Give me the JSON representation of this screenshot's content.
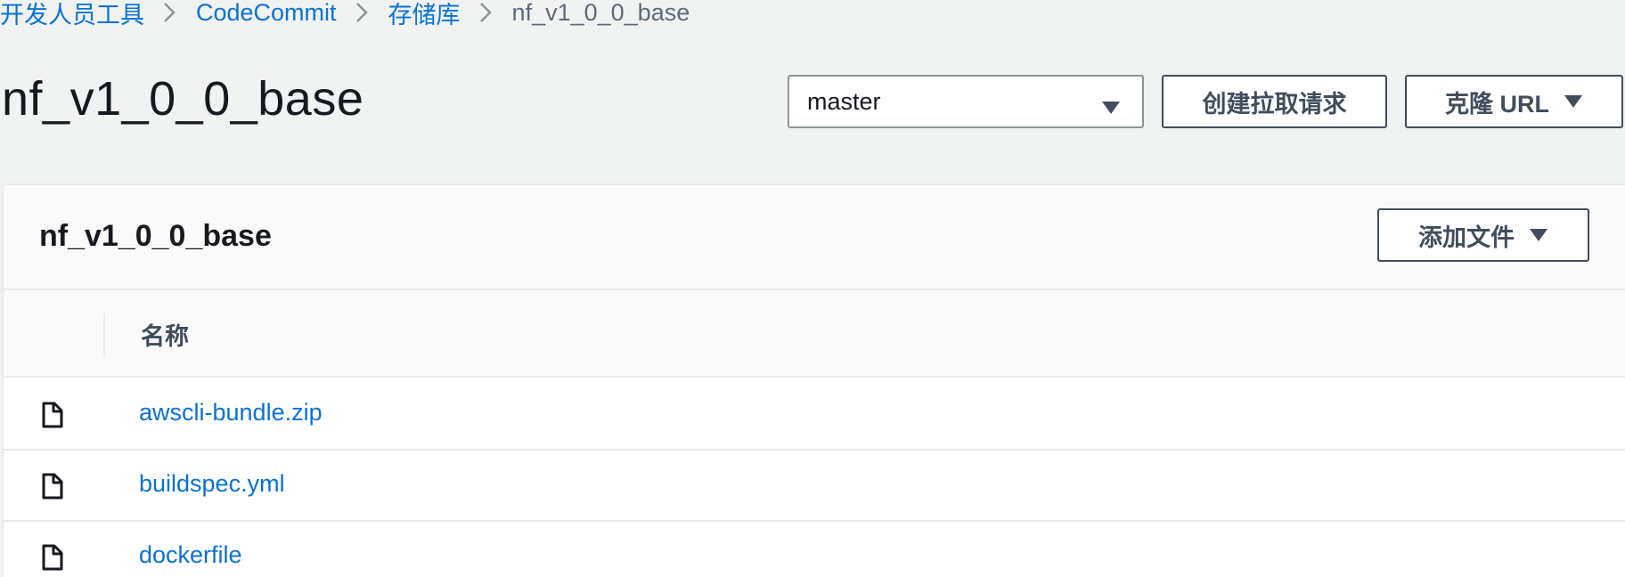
{
  "breadcrumb": {
    "items": [
      {
        "label": "开发人员工具"
      },
      {
        "label": "CodeCommit"
      },
      {
        "label": "存储库"
      },
      {
        "label": "nf_v1_0_0_base"
      }
    ]
  },
  "header": {
    "title": "nf_v1_0_0_base",
    "branch_select": {
      "value": "master",
      "icon": "caret-down-icon"
    },
    "create_pr_label": "创建拉取请求",
    "clone_url_label": "克隆 URL"
  },
  "panel": {
    "title": "nf_v1_0_0_base",
    "add_file_label": "添加文件",
    "columns": [
      {
        "label": "名称"
      }
    ],
    "files": [
      {
        "name": "awscli-bundle.zip",
        "icon": "file-icon"
      },
      {
        "name": "buildspec.yml",
        "icon": "file-icon"
      },
      {
        "name": "dockerfile",
        "icon": "file-icon"
      }
    ]
  },
  "colors": {
    "link": "#0972d3",
    "page_bg": "#f1f2f2",
    "button_border": "#414d5c"
  }
}
